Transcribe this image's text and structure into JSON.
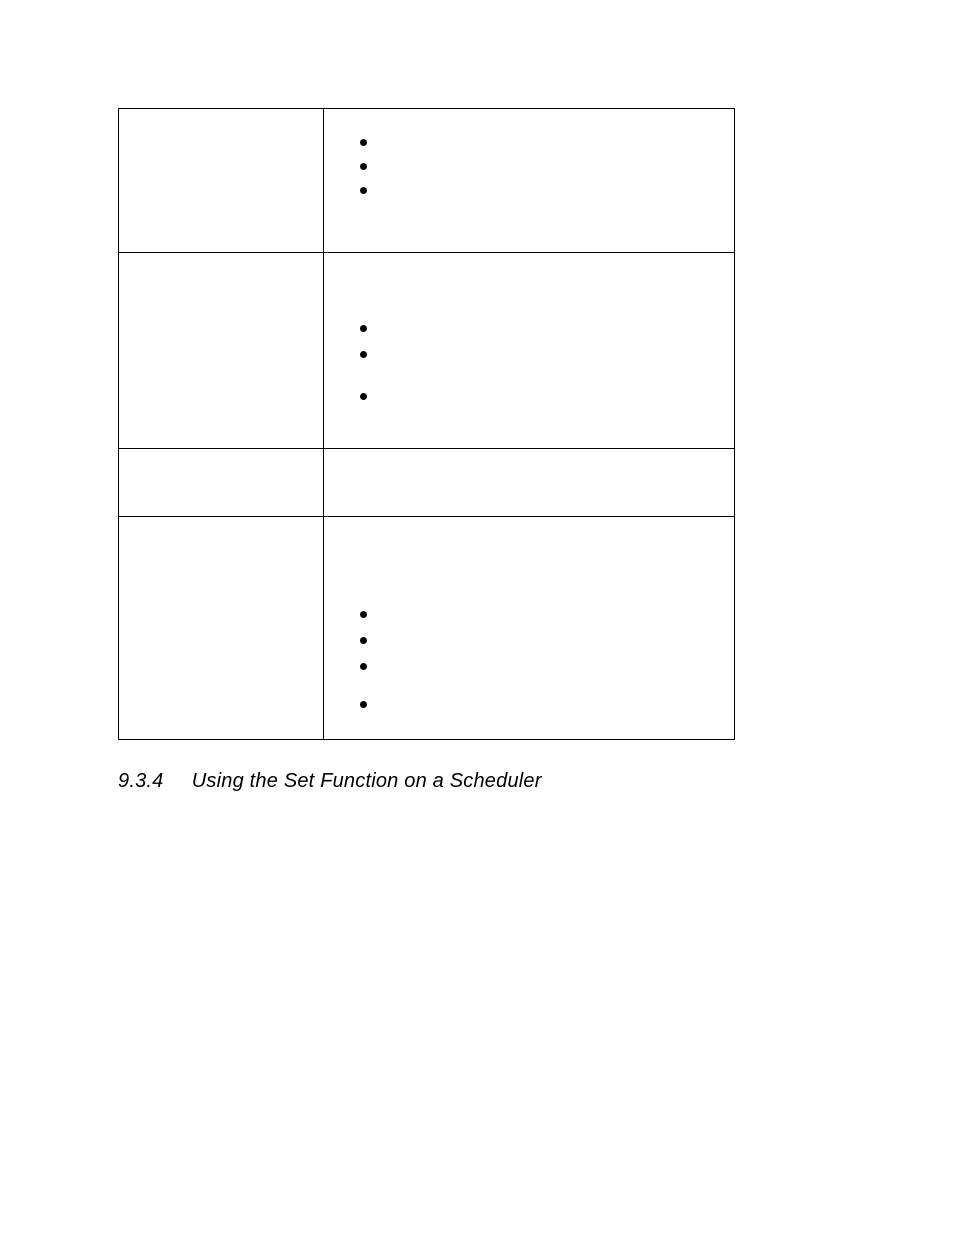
{
  "table": {
    "rows": [
      {
        "left": "",
        "right_bullets": [
          "",
          "",
          ""
        ]
      },
      {
        "left": "",
        "right_bullets": [
          "",
          "",
          ""
        ]
      },
      {
        "left": "",
        "right_text": ""
      },
      {
        "left": "",
        "right_bullets": [
          "",
          "",
          "",
          ""
        ]
      }
    ]
  },
  "heading": {
    "number": "9.3.4",
    "title": "Using the Set Function on a Scheduler"
  }
}
